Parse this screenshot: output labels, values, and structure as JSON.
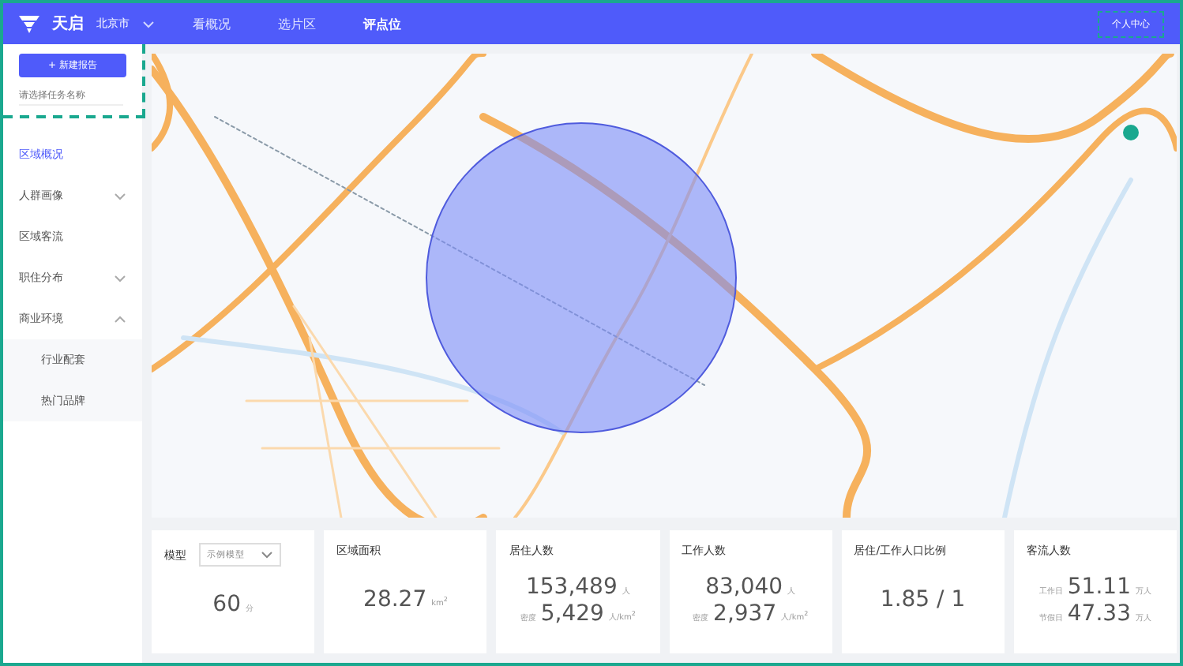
{
  "header": {
    "logo": "天启",
    "city": "北京市",
    "nav": [
      {
        "label": "看概况",
        "selected": false
      },
      {
        "label": "选片区",
        "selected": false
      },
      {
        "label": "评点位",
        "selected": true
      }
    ],
    "user": "个人中心"
  },
  "sidebar": {
    "new_button": "+ 新建报告",
    "task_field": {
      "placeholder": "请选择任务名称"
    },
    "items": [
      {
        "label": "区域概况",
        "selected": true
      },
      {
        "label": "人群画像",
        "selected": false,
        "expanded": false
      },
      {
        "label": "区域客流",
        "selected": false
      },
      {
        "label": "职住分布",
        "selected": false,
        "expanded": false
      },
      {
        "label": "商业环境",
        "selected": false,
        "expanded": true,
        "children": [
          {
            "label": "行业配套",
            "selected": false
          },
          {
            "label": "热门品牌",
            "selected": false
          }
        ]
      }
    ]
  },
  "cards": [
    {
      "label": "模型",
      "select": "示例模型",
      "rows": [
        {
          "value": "60",
          "unit": "分"
        }
      ]
    },
    {
      "label": "区域面积",
      "rows": [
        {
          "value": "28.27",
          "unit": "km$^{2}$"
        }
      ]
    },
    {
      "label": "居住人数",
      "rows": [
        {
          "value": "153,489",
          "unit": "人"
        },
        {
          "label": "密度",
          "value": "5,429",
          "unit": "人/km$^{2}$"
        }
      ]
    },
    {
      "label": "工作人数",
      "rows": [
        {
          "value": "83,040",
          "unit": "人"
        },
        {
          "label": "密度",
          "value": "2,937",
          "unit": "人/km$^{2}$"
        }
      ]
    },
    {
      "label": "居住/工作人口比例",
      "rows": [
        {
          "value": "1.85 / 1"
        }
      ]
    },
    {
      "label": "客流人数",
      "rows": [
        {
          "label": "工作日",
          "value": "51.11",
          "unit": "万人"
        },
        {
          "label": "节假日",
          "value": "47.33",
          "unit": "万人"
        }
      ]
    }
  ]
}
